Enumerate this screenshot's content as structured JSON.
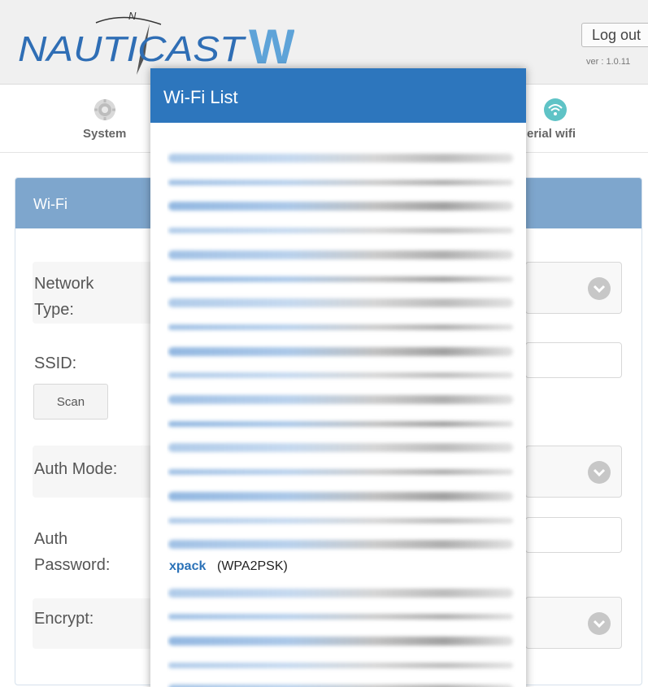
{
  "header": {
    "logo_text": "NAUTICAST",
    "logo_letter": "W",
    "logo_compass_letter": "N",
    "logout_label": "Log out",
    "version": "ver : 1.0.11"
  },
  "nav": {
    "items": [
      {
        "label": "System",
        "icon": "gear-icon"
      },
      {
        "label": "erial wifi",
        "icon": "wifi-icon"
      }
    ]
  },
  "panel": {
    "title": "Wi-Fi",
    "network_type_label": "Network\nType:",
    "ssid_label": "SSID:",
    "scan_label": "Scan",
    "auth_mode_label": "Auth Mode:",
    "auth_password_label": "Auth\nPassword:",
    "encrypt_label": "Encrypt:"
  },
  "modal": {
    "title": "Wi-Fi List",
    "visible_network": {
      "ssid": "xpack",
      "auth": "(WPA2PSK)"
    },
    "obscured_entry_count": 22
  },
  "colors": {
    "modal_header": "#2d76bd",
    "panel_header": "#7ea6cd",
    "ssid_link": "#2b72b8"
  }
}
